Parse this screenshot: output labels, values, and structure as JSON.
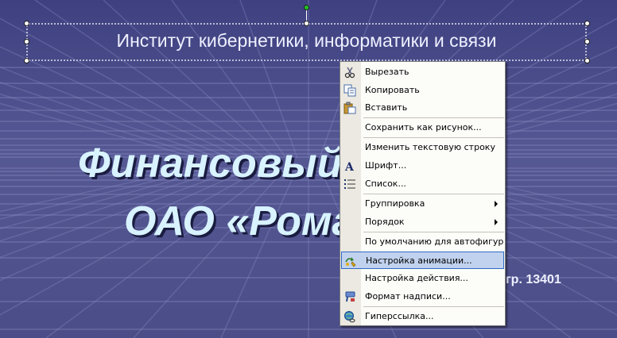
{
  "slide": {
    "title": "Институт кибернетики, информатики и связи",
    "heading_line1": "Финансовый анализ",
    "heading_line2": "ОАО «Ромашка»",
    "author": "гр. 13401"
  },
  "context_menu": {
    "items": [
      {
        "label": "Вырезать",
        "icon": "scissors-icon"
      },
      {
        "label": "Копировать",
        "icon": "copy-icon"
      },
      {
        "label": "Вставить",
        "icon": "paste-icon"
      },
      {
        "label": "Сохранить как рисунок...",
        "icon": ""
      },
      {
        "label": "Изменить текстовую строку",
        "icon": ""
      },
      {
        "label": "Шрифт...",
        "icon": "font-icon"
      },
      {
        "label": "Список...",
        "icon": "list-icon"
      },
      {
        "label": "Группировка",
        "icon": "",
        "submenu": true
      },
      {
        "label": "Порядок",
        "icon": "",
        "submenu": true
      },
      {
        "label": "По умолчанию для автофигур",
        "icon": ""
      },
      {
        "label": "Настройка анимации...",
        "icon": "animation-icon",
        "highlighted": true
      },
      {
        "label": "Настройка действия...",
        "icon": ""
      },
      {
        "label": "Формат надписи...",
        "icon": "format-icon"
      },
      {
        "label": "Гиперссылка...",
        "icon": "hyperlink-icon"
      }
    ]
  },
  "colors": {
    "slide_background": "#4a4c8a",
    "heading_text": "#d8f3ff",
    "menu_highlight": "#c1d2ee",
    "menu_highlight_border": "#316ac5"
  }
}
